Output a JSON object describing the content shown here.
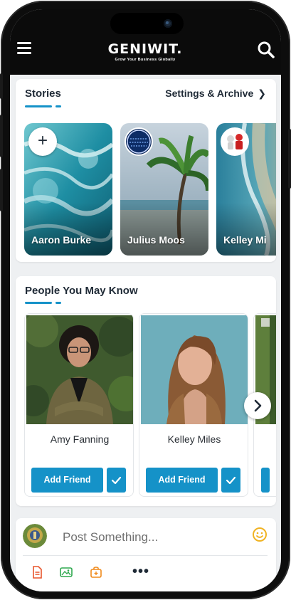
{
  "header": {
    "brand": "GENIWIT.",
    "tagline": "Grow Your Business Globally"
  },
  "stories": {
    "title": "Stories",
    "settings_label": "Settings & Archive",
    "items": [
      {
        "name": "Aaron Burke"
      },
      {
        "name": "Julius Moos"
      },
      {
        "name": "Kelley Mi"
      }
    ]
  },
  "people": {
    "title": "People You May Know",
    "items": [
      {
        "name": "Amy Fanning",
        "add_label": "Add Friend"
      },
      {
        "name": "Kelley Miles",
        "add_label": "Add Friend"
      }
    ]
  },
  "post": {
    "placeholder": "Post Something..."
  },
  "colors": {
    "accent": "#1592c8",
    "header_bg": "#0b0b0b",
    "page_bg": "#eef0f2"
  },
  "icons": {
    "menu": "menu-icon",
    "search": "search-icon",
    "add": "plus-icon",
    "chevron": "chevron-right-icon",
    "check": "check-icon",
    "next": "chevron-right-icon",
    "emoji": "smiley-icon",
    "document": "document-icon",
    "image": "image-icon",
    "bag": "shopping-bag-icon",
    "more": "more-dots-icon"
  }
}
